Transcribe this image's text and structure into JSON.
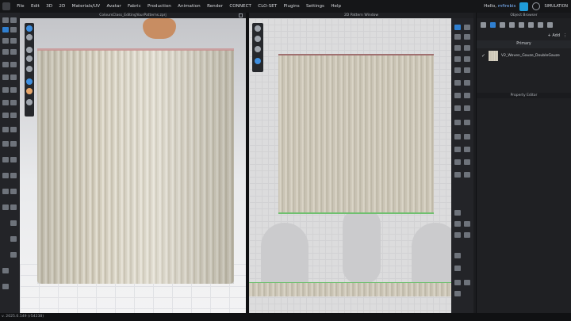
{
  "menu": {
    "items": [
      "File",
      "Edit",
      "3D",
      "2D",
      "Materials/UV",
      "Avatar",
      "Fabric",
      "Production",
      "Animation",
      "Render",
      "CONNECT",
      "CLO-SET",
      "Plugins",
      "Settings",
      "Help"
    ],
    "greeting": "Hello,",
    "username": "mfirebis",
    "mode_label": "SIMULATION"
  },
  "viewport3d": {
    "title": "ColoursClass_EditingYourPatterns.zprj"
  },
  "viewport2d": {
    "title": "2D Pattern Window"
  },
  "side_panel": {
    "object_browser_title": "Object Browser",
    "add_label": "Add",
    "section_label": "Primary",
    "fabric_name": "V2_Woven_Gauze_DoubleGauze",
    "property_editor_title": "Property Editor"
  },
  "status_bar": {
    "version": "v. 2025.0.149 (r54238)"
  },
  "colors": {
    "accent": "#2f7fd0",
    "fabric": "#d6d0c1",
    "seam_green": "#6fc06f"
  }
}
